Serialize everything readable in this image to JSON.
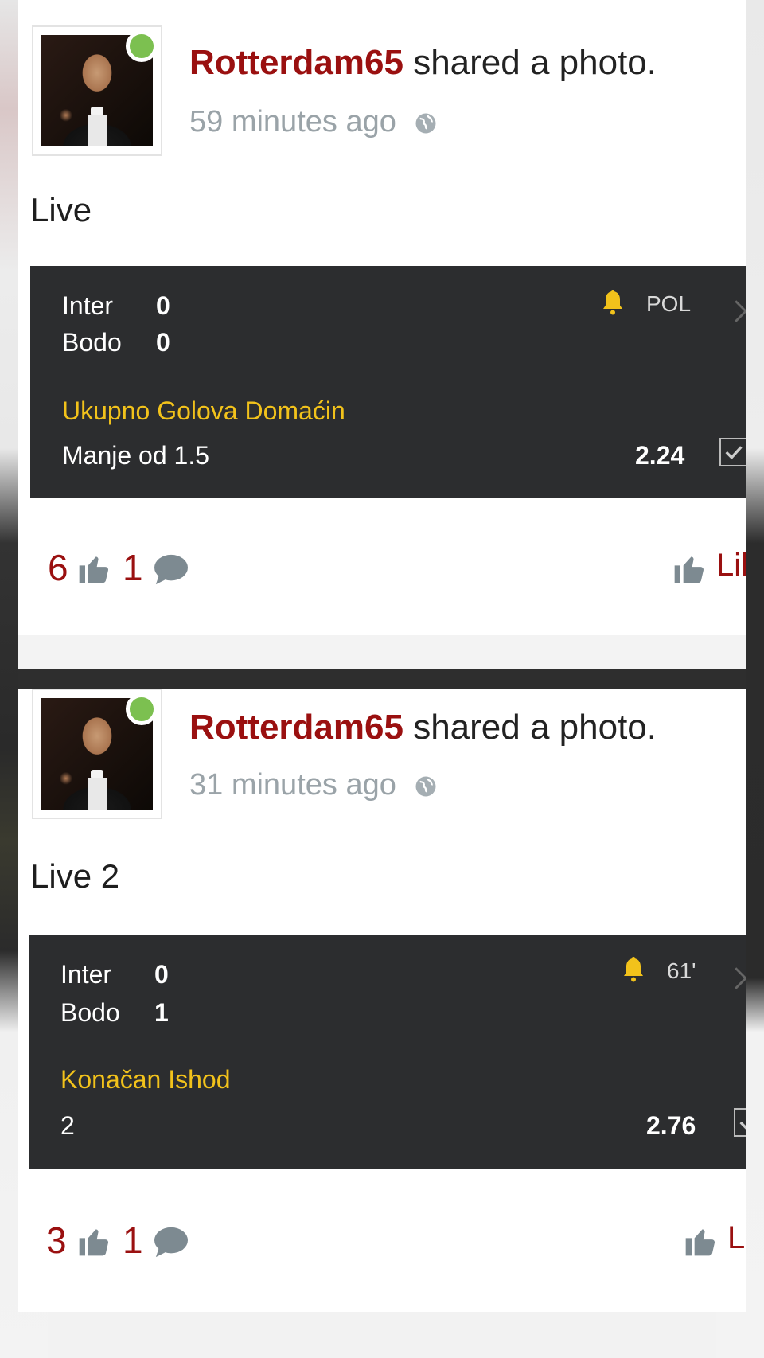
{
  "posts": [
    {
      "user": "Rotterdam65",
      "action": "shared a photo.",
      "time": "59 minutes ago",
      "text": "Live",
      "bet": {
        "home_team": "Inter",
        "home_score": "0",
        "away_team": "Bodo",
        "away_score": "0",
        "status": "POL",
        "market": "Ukupno Golova Domaćin",
        "pick": "Manje od 1.5",
        "odds": "2.24"
      },
      "likes": "6",
      "comments": "1",
      "like_label": "Lik"
    },
    {
      "user": "Rotterdam65",
      "action": "shared a photo.",
      "time": "31 minutes ago",
      "text": "Live 2",
      "bet": {
        "home_team": "Inter",
        "home_score": "0",
        "away_team": "Bodo",
        "away_score": "1",
        "status": "61'",
        "market": "Konačan Ishod",
        "pick": "2",
        "odds": "2.76"
      },
      "likes": "3",
      "comments": "1",
      "like_label": "Li"
    }
  ],
  "colors": {
    "username": "#9a1010",
    "market": "#f2c21b",
    "online": "#7cc050",
    "bet_bg": "#2c2d2f"
  },
  "icons": [
    "globe-icon",
    "bell-icon",
    "close-icon",
    "checkbox-icon",
    "thumbs-up-icon",
    "comment-icon"
  ]
}
